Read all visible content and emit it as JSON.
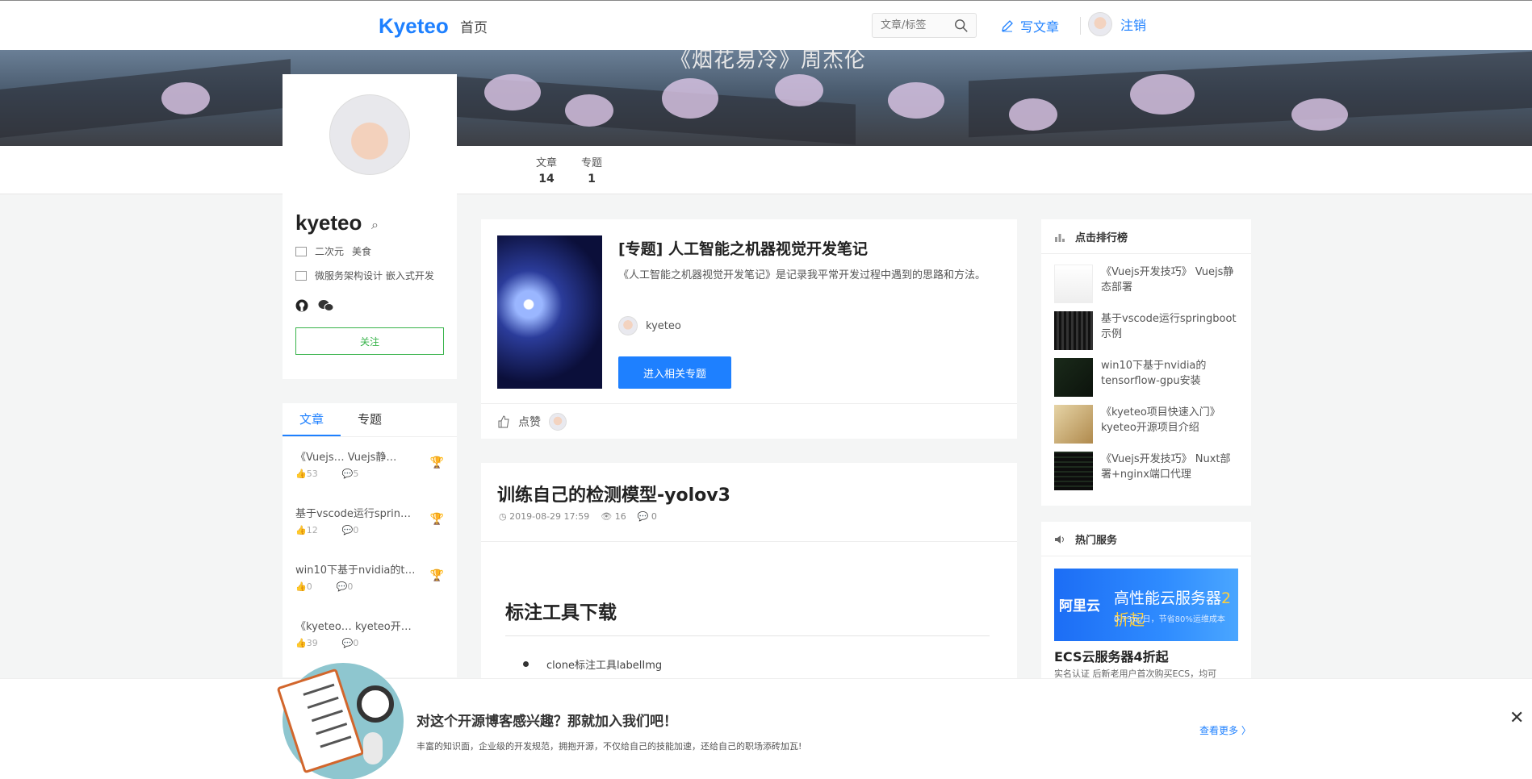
{
  "header": {
    "logo": "Kyeteo",
    "nav_home": "首页",
    "search_placeholder": "文章/标签",
    "write_label": "写文章",
    "logout_label": "注销"
  },
  "banner": {
    "title": "《烟花易冷》周杰伦"
  },
  "profile": {
    "stats": [
      {
        "label": "文章",
        "value": "14"
      },
      {
        "label": "专题",
        "value": "1"
      }
    ],
    "username": "kyeteo",
    "tags_row1": [
      "二次元",
      "美食"
    ],
    "tags_row2": "微服务架构设计 嵌入式开发",
    "follow_label": "关注"
  },
  "article_list": {
    "tabs": [
      "文章",
      "专题"
    ],
    "items": [
      {
        "title": "《Vuejs…  Vuejs静…",
        "likes": "53",
        "comments": "5"
      },
      {
        "title": "基于vscode运行sprin…",
        "likes": "12",
        "comments": "0"
      },
      {
        "title": "win10下基于nvidia的t…",
        "likes": "0",
        "comments": "0"
      },
      {
        "title": "《kyeteo…  kyeteo开…",
        "likes": "39",
        "comments": "0"
      }
    ]
  },
  "topic": {
    "title": "[专题] 人工智能之机器视觉开发笔记",
    "description": "《人工智能之机器视觉开发笔记》是记录我平常开发过程中遇到的思路和方法。",
    "author": "kyeteo",
    "button": "进入相关专题",
    "like_label": "点赞"
  },
  "article": {
    "title": "训练自己的检测模型-yolov3",
    "date": "2019-08-29 17:59",
    "views": "16",
    "comments": "0",
    "h2": "标注工具下载",
    "bullet": "clone标注工具labelImg"
  },
  "ranking": {
    "title": "点击排行榜",
    "items": [
      "《Vuejs开发技巧》 Vuejs静态部署",
      "基于vscode运行springboot示例",
      "win10下基于nvidia的tensorflow-gpu安装",
      "《kyeteo项目快速入门》 kyeteo开源项目介绍",
      "《Vuejs开发技巧》 Nuxt部署+nginx端口代理"
    ]
  },
  "hot_service": {
    "title": "热门服务",
    "ad_logo": "阿里云",
    "ad_main": "高性能云服务器",
    "ad_main_highlight": "2折起",
    "ad_sub": "0.73元/日，节省80%运维成本",
    "ad_title": "ECS云服务器4折起",
    "ad_desc": "实名认证 后新老用户首次购买ECS，均可"
  },
  "promo": {
    "title": "对这个开源博客感兴趣？那就加入我们吧！",
    "subtitle": "丰富的知识面，企业级的开发规范，拥抱开源，不仅给自己的技能加速，还给自己的职场添砖加瓦!",
    "more": "查看更多 〉",
    "close": "✕"
  },
  "colors": {
    "accent": "#1e80ff",
    "follow": "#37b34a"
  }
}
